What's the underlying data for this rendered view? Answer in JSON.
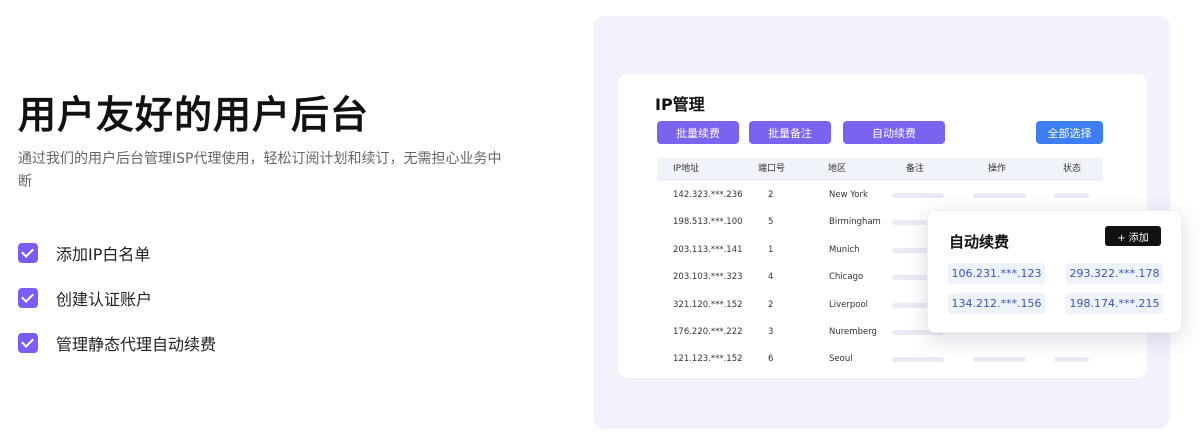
{
  "hero": {
    "title": "用户友好的用户后台",
    "description": "通过我们的用户后台管理ISP代理使用，轻松订阅计划和续订，无需担心业务中断",
    "features": [
      "添加IP白名单",
      "创建认证账户",
      "管理静态代理自动续费"
    ]
  },
  "ip_panel": {
    "title": "IP管理",
    "buttons": {
      "batch_renew": "批量续费",
      "batch_note": "批量备注",
      "auto_renew": "自动续费",
      "select_all": "全部选择"
    },
    "columns": [
      "IP地址",
      "端口号",
      "地区",
      "备注",
      "操作",
      "状态"
    ],
    "rows": [
      {
        "ip": "142.323.***.236",
        "port": "2",
        "region": "New York"
      },
      {
        "ip": "198.513.***.100",
        "port": "5",
        "region": "Birmingham"
      },
      {
        "ip": "203.113.***.141",
        "port": "1",
        "region": "Munich"
      },
      {
        "ip": "203.103.***.323",
        "port": "4",
        "region": "Chicago"
      },
      {
        "ip": "321.120.***.152",
        "port": "2",
        "region": "Liverpool"
      },
      {
        "ip": "176.220.***.222",
        "port": "3",
        "region": "Nuremberg"
      },
      {
        "ip": "121.123.***.152",
        "port": "6",
        "region": "Seoul"
      }
    ]
  },
  "popup": {
    "title": "自动续费",
    "add_label": "+ 添加",
    "ips": [
      "106.231.***.123",
      "293.322.***.178",
      "134.212.***.156",
      "198.174.***.215"
    ]
  },
  "colors": {
    "accent_purple": "#7b63f0",
    "accent_blue": "#3d7ff3",
    "panel_bg": "#f1f2fb"
  }
}
